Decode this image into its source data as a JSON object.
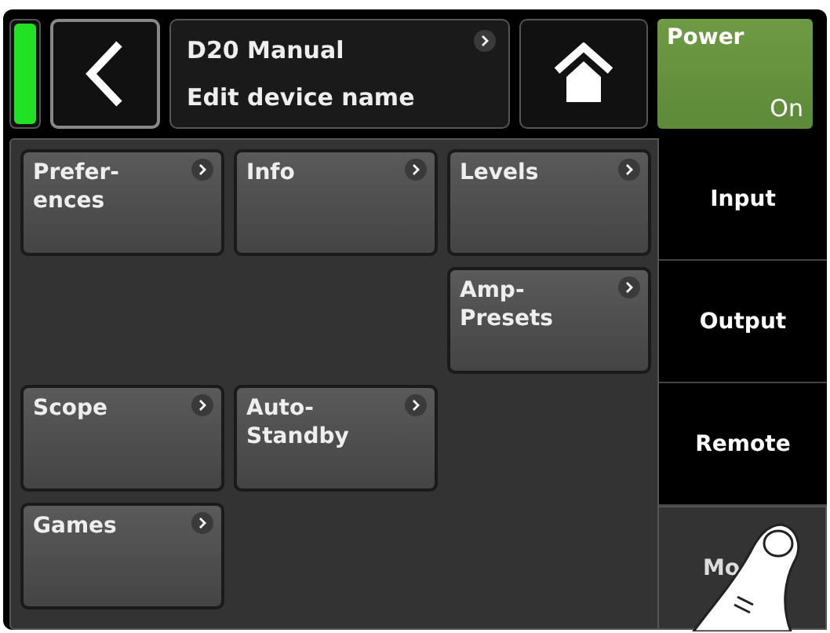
{
  "status_led": {
    "on": true
  },
  "header": {
    "title": "D20 Manual",
    "subtitle": "Edit device name"
  },
  "power": {
    "label": "Power",
    "state": "On",
    "on": true
  },
  "grid_rows": [
    [
      {
        "kind": "button",
        "label": "Prefer-\nences"
      },
      {
        "kind": "button",
        "label": "Info"
      },
      {
        "kind": "button",
        "label": "Levels"
      }
    ],
    [
      {
        "kind": "blank"
      },
      {
        "kind": "blank"
      },
      {
        "kind": "button",
        "label": "Amp-\nPresets"
      }
    ],
    [
      {
        "kind": "button",
        "label": "Scope"
      },
      {
        "kind": "button",
        "label": "Auto-\nStandby"
      },
      {
        "kind": "blank"
      }
    ],
    [
      {
        "kind": "button",
        "label": "Games"
      },
      {
        "kind": "blank"
      },
      {
        "kind": "blank"
      }
    ]
  ],
  "tabs": [
    {
      "label": "Input",
      "selected": false
    },
    {
      "label": "Output",
      "selected": false
    },
    {
      "label": "Remote",
      "selected": false
    },
    {
      "label": "Mo",
      "selected": true
    }
  ]
}
